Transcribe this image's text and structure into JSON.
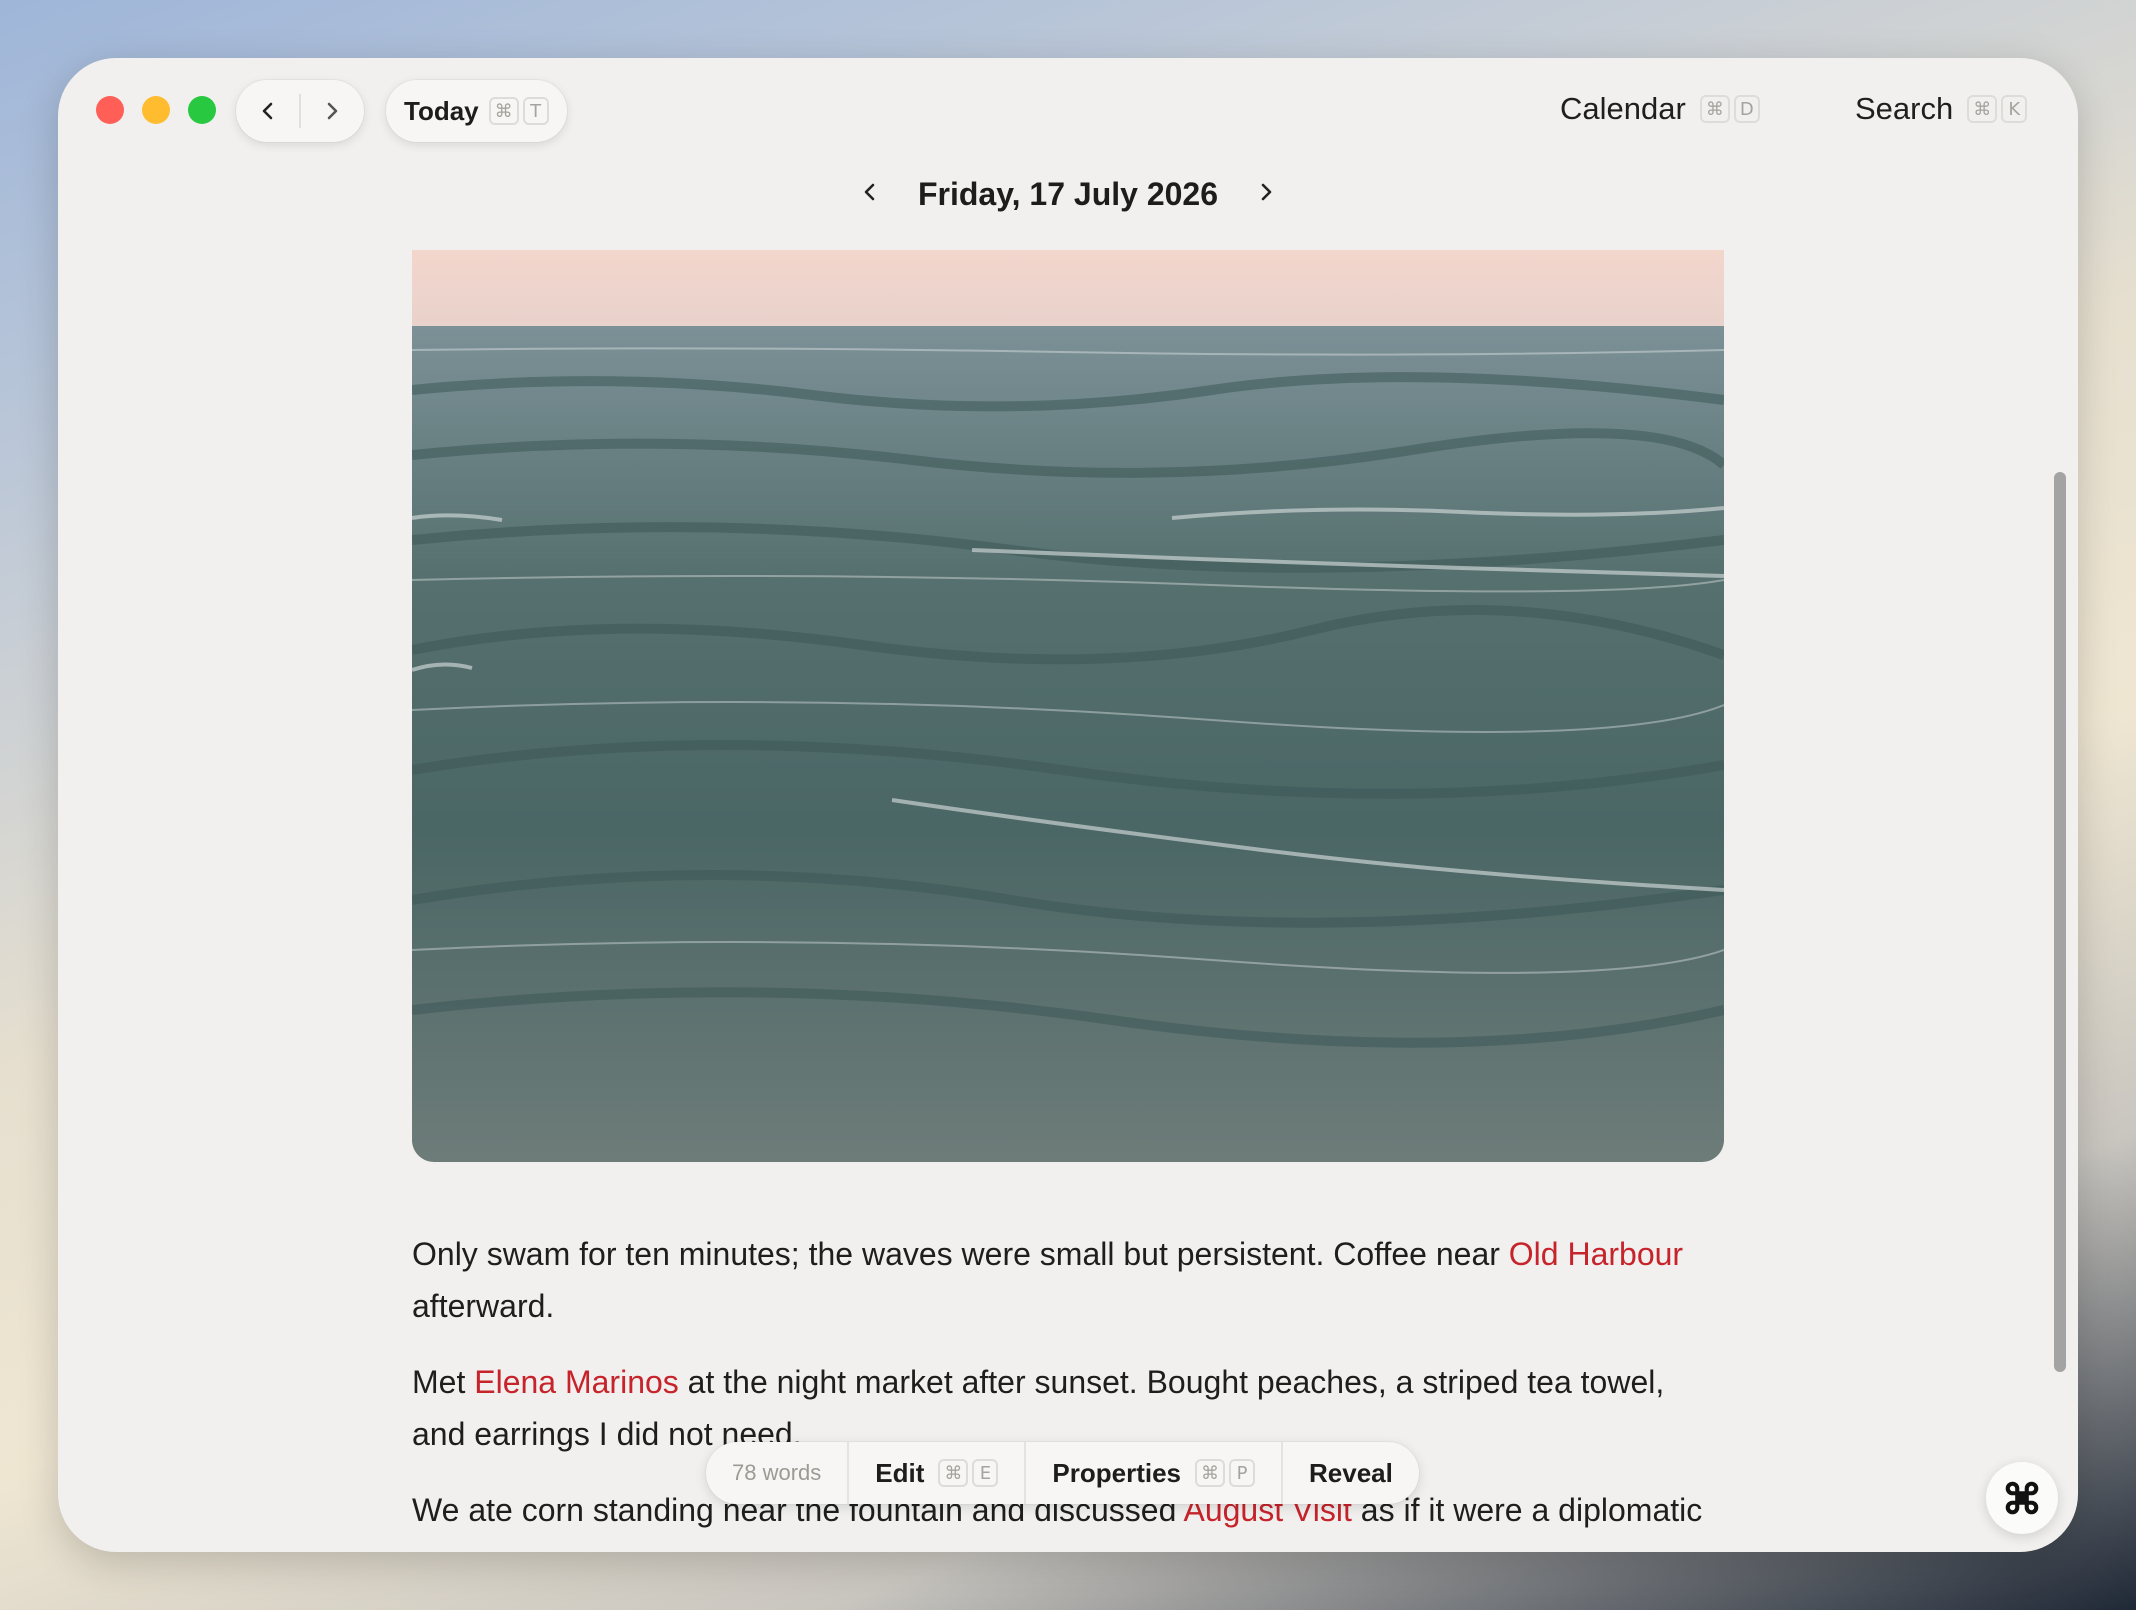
{
  "toolbar": {
    "today_label": "Today",
    "today_kbd": [
      "⌘",
      "T"
    ],
    "calendar_label": "Calendar",
    "calendar_kbd": [
      "⌘",
      "D"
    ],
    "search_label": "Search",
    "search_kbd": [
      "⌘",
      "K"
    ]
  },
  "entry": {
    "date": "Friday, 17 July 2026",
    "paragraphs": [
      {
        "parts": [
          {
            "text": "Only swam for ten minutes; the waves were small but persistent. Coffee near "
          },
          {
            "text": "Old Harbour",
            "link": true
          },
          {
            "text": " afterward."
          }
        ]
      },
      {
        "parts": [
          {
            "text": "Met "
          },
          {
            "text": "Elena Marinos",
            "link": true
          },
          {
            "text": " at the night market after sunset. Bought peaches, a striped tea towel, and earrings I did not need."
          }
        ]
      },
      {
        "parts": [
          {
            "text": "We ate corn standing near the fountain and discussed "
          },
          {
            "text": "August Visit",
            "link": true
          },
          {
            "text": " as if it were a diplomatic"
          }
        ]
      }
    ]
  },
  "bottombar": {
    "word_count": "78 words",
    "edit_label": "Edit",
    "edit_kbd": [
      "⌘",
      "E"
    ],
    "properties_label": "Properties",
    "properties_kbd": [
      "⌘",
      "P"
    ],
    "reveal_label": "Reveal"
  },
  "icons": {
    "back": "chevron-left-icon",
    "forward": "chevron-right-icon",
    "fab": "command-icon"
  },
  "colors": {
    "link": "#c7232b",
    "window_bg": "#f1f0ee"
  }
}
